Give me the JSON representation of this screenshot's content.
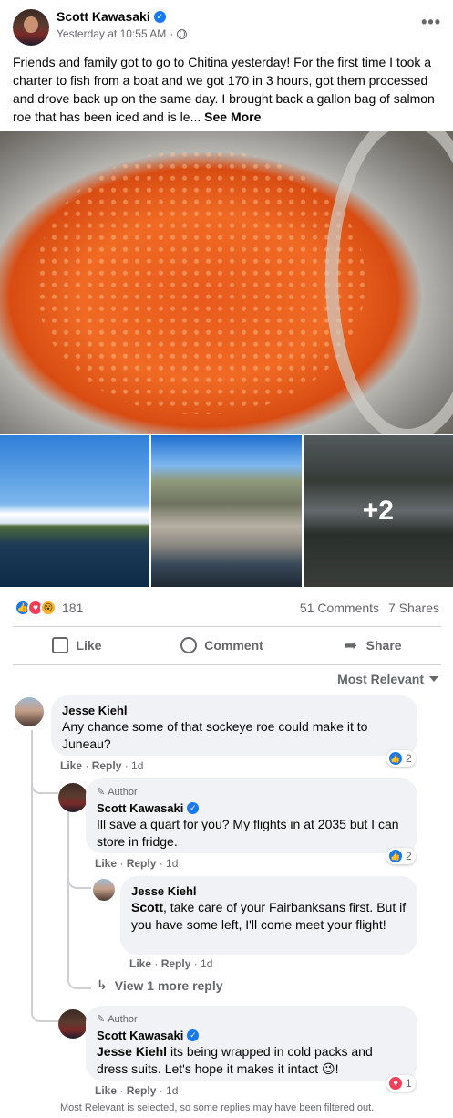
{
  "post": {
    "author": "Scott Kawasaki",
    "timestamp": "Yesterday at 10:55 AM",
    "more_icon": "more-horizontal-icon",
    "text": "Friends and family got to go to Chitina yesterday! For the first time I took a charter to fish from a boat and we got 170 in 3 hours, got them processed and drove back up on the same day. I brought back a gallon bag of salmon roe that has been iced and is le...",
    "see_more": "See More",
    "extra_photos": "+2"
  },
  "stats": {
    "reaction_count": "181",
    "comments": "51 Comments",
    "shares": "7 Shares"
  },
  "actions": {
    "like": "Like",
    "comment": "Comment",
    "share": "Share"
  },
  "filter": {
    "label": "Most Relevant"
  },
  "comments": [
    {
      "author": "Jesse Kiehl",
      "text": "Any chance some of that sockeye roe could make it to Juneau?",
      "like": "Like",
      "reply": "Reply",
      "time": "1d",
      "reactions": "2",
      "replies": [
        {
          "author_badge": "Author",
          "author": "Scott Kawasaki",
          "text": "Ill save a quart for you? My flights in at 2035 but I can store in fridge.",
          "like": "Like",
          "reply": "Reply",
          "time": "1d",
          "reactions": "2"
        },
        {
          "author": "Jesse Kiehl",
          "mention": "Scott",
          "text": ", take care of your Fairbanksans first. But if you have some left, I'll come meet your flight!",
          "like": "Like",
          "reply": "Reply",
          "time": "1d"
        }
      ],
      "view_more": "View 1 more reply"
    },
    {
      "author_badge": "Author",
      "author": "Scott Kawasaki",
      "mention": "Jesse Kiehl",
      "text": " its being wrapped in cold packs and dress suits. Let's hope it makes it intact 😉!",
      "like": "Like",
      "reply": "Reply",
      "time": "1d",
      "reactions": "1"
    }
  ],
  "footer_note": "Most Relevant is selected, so some replies may have been filtered out.",
  "colors": {
    "facebook_blue": "#1877f2",
    "love_red": "#f33e58",
    "wow_yellow": "#f7b125",
    "secondary_text": "#65676b",
    "bubble_bg": "#f0f2f5"
  }
}
